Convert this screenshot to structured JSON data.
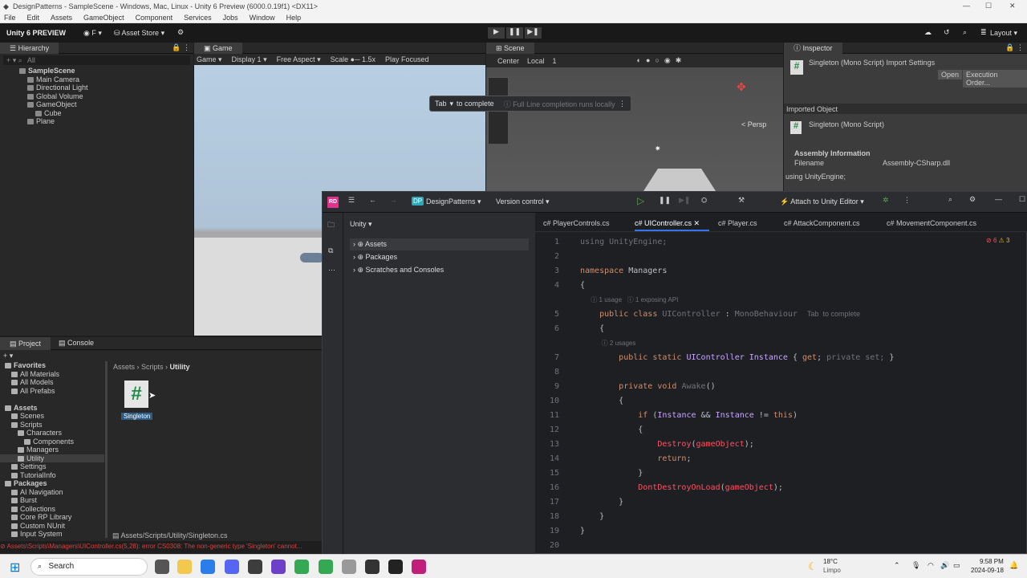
{
  "window": {
    "title": "DesignPatterns - SampleScene - Windows, Mac, Linux - Unity 6 Preview (6000.0.19f1) <DX11>"
  },
  "menu": [
    "File",
    "Edit",
    "Assets",
    "GameObject",
    "Component",
    "Services",
    "Jobs",
    "Window",
    "Help"
  ],
  "toolbar": {
    "brand": "Unity 6 PREVIEW",
    "account": "F",
    "asset_store": "Asset Store",
    "layout": "Layout"
  },
  "hierarchy": {
    "title": "Hierarchy",
    "search": "All",
    "items": [
      "SampleScene",
      "Main Camera",
      "Directional Light",
      "Global Volume",
      "GameObject",
      "Cube",
      "Plane"
    ]
  },
  "game": {
    "title": "Game",
    "view": "Game",
    "display": "Display 1",
    "aspect": "Free Aspect",
    "scale_label": "Scale",
    "scale": "1.5x",
    "play": "Play Focused"
  },
  "scene": {
    "title": "Scene",
    "pivot": "Center",
    "space": "Local",
    "grid": "1",
    "persp": "< Persp"
  },
  "inspector": {
    "title": "Inspector",
    "asset": "Singleton (Mono Script) Import Settings",
    "open": "Open",
    "exec_order": "Execution Order...",
    "imported": "Imported Object",
    "obj": "Singleton (Mono Script)",
    "asm_title": "Assembly Information",
    "filename_label": "Filename",
    "filename": "Assembly-CSharp.dll",
    "preview": "using UnityEngine;"
  },
  "completion": {
    "key": "Tab",
    "text": "to complete",
    "hint": "Full Line completion runs locally"
  },
  "project": {
    "tabs": [
      "Project",
      "Console"
    ],
    "breadcrumb": [
      "Assets",
      "Scripts",
      "Utility"
    ],
    "tree": [
      {
        "t": "Favorites",
        "b": true,
        "i": 0
      },
      {
        "t": "All Materials",
        "i": 1
      },
      {
        "t": "All Models",
        "i": 1
      },
      {
        "t": "All Prefabs",
        "i": 1
      },
      {
        "t": "",
        "i": 0
      },
      {
        "t": "Assets",
        "b": true,
        "i": 0
      },
      {
        "t": "Scenes",
        "i": 1
      },
      {
        "t": "Scripts",
        "i": 1
      },
      {
        "t": "Characters",
        "i": 2
      },
      {
        "t": "Components",
        "i": 3
      },
      {
        "t": "Managers",
        "i": 2
      },
      {
        "t": "Utility",
        "i": 2
      },
      {
        "t": "Settings",
        "i": 1
      },
      {
        "t": "TutorialInfo",
        "i": 1
      },
      {
        "t": "Packages",
        "b": true,
        "i": 0
      },
      {
        "t": "AI Navigation",
        "i": 1
      },
      {
        "t": "Burst",
        "i": 1
      },
      {
        "t": "Collections",
        "i": 1
      },
      {
        "t": "Core RP Library",
        "i": 1
      },
      {
        "t": "Custom NUnit",
        "i": 1
      },
      {
        "t": "Input System",
        "i": 1
      }
    ],
    "file": "Singleton",
    "path": "Assets/Scripts/Utility/Singleton.cs"
  },
  "error": "Assets\\Scripts\\Managers\\UIController.cs(5,28): error CS0308: The non-generic type 'Singleton' cannot...",
  "rider": {
    "logo": "RD",
    "project_badge": "DP",
    "project": "DesignPatterns",
    "vcs": "Version control",
    "attach": "Attach to Unity Editor",
    "view": "Unity",
    "tree": [
      "Assets",
      "Packages",
      "Scratches and Consoles"
    ],
    "tabs": [
      "PlayerControls.cs",
      "UIController.cs",
      "Player.cs",
      "AttackComponent.cs",
      "MovementComponent.cs"
    ],
    "errors": "6",
    "warnings": "3"
  },
  "taskbar": {
    "search": "Search",
    "temp": "18°C",
    "weather": "Limpo",
    "time": "9:58 PM",
    "date": "2024-09-18"
  }
}
